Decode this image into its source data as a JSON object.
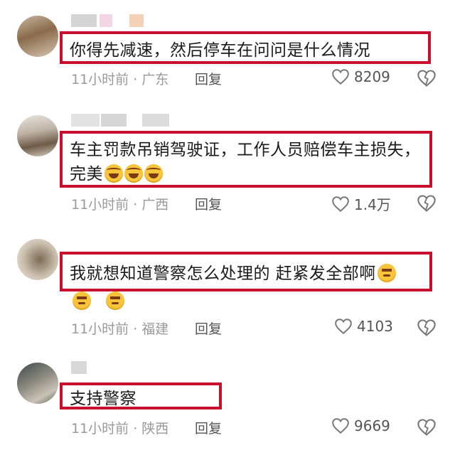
{
  "comments": [
    {
      "text": "你得先减速，然后停车在问问是什么情况",
      "time_location": "11小时前 · 广东",
      "reply_label": "回复",
      "like_count": "8209"
    },
    {
      "text": "车主罚款吊销驾驶证，工作人员赔偿车主损失，完美",
      "time_location": "11小时前 · 广西",
      "reply_label": "回复",
      "like_count": "1.4万"
    },
    {
      "text": "我就想知道警察怎么处理的 赶紧发全部啊",
      "time_location": "11小时前 · 福建",
      "reply_label": "回复",
      "like_count": "4103"
    },
    {
      "text": "支持警察",
      "time_location": "11小时前 · 陕西",
      "reply_label": "回复",
      "like_count": "9669"
    }
  ],
  "icons": {
    "like": "heart-outline-icon",
    "dislike": "broken-heart-icon",
    "emoji_laugh": "laugh-cry-emoji",
    "emoji_think": "thinking-emoji"
  },
  "colors": {
    "highlight_border": "#c8102e",
    "meta_text": "#9a9a9a"
  }
}
